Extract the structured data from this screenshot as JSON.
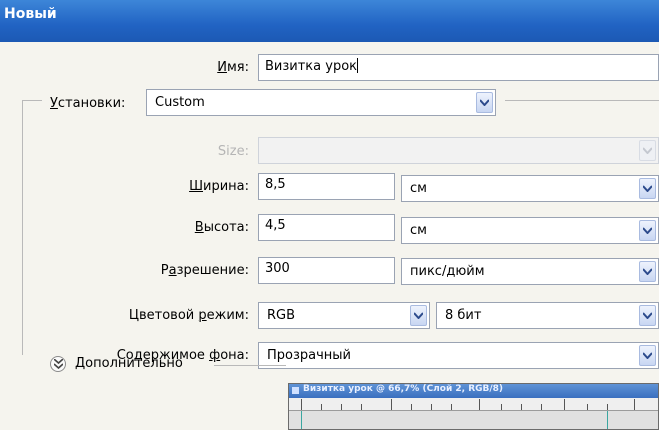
{
  "window": {
    "title": "Новый"
  },
  "form": {
    "name": {
      "label": "Имя:",
      "mnemonic": "И",
      "label_rest": "мя:",
      "value": "Визитка урок"
    },
    "preset": {
      "label": "Установки:",
      "mnemonic": "У",
      "label_rest": "становки:",
      "value": "Custom"
    },
    "size": {
      "label": "Size:",
      "value": ""
    },
    "width": {
      "label": "Ширина:",
      "mnemonic": "Ш",
      "label_rest": "ирина:",
      "value": "8,5",
      "unit": "см"
    },
    "height": {
      "label": "Высота:",
      "mnemonic": "В",
      "label_rest": "ысота:",
      "value": "4,5",
      "unit": "см"
    },
    "resolution": {
      "label": "Разрешение:",
      "pre": "Р",
      "mnemonic": "а",
      "label_rest": "зрешение:",
      "value": "300",
      "unit": "пикс/дюйм"
    },
    "color_mode": {
      "label": "Цветовой режим:",
      "pre": "Цветовой ",
      "mnemonic": "р",
      "label_rest": "ежим:",
      "value": "RGB",
      "depth": "8 бит"
    },
    "background": {
      "label": "Содержимое фона:",
      "pre": "Содержимое ",
      "mnemonic": "ф",
      "label_rest": "она:",
      "value": "Прозрачный"
    },
    "advanced": {
      "label": "Дополнительно"
    }
  },
  "thumbnail": {
    "title": "Визитка урок @ 66,7% (Слой 2, RGB/8)"
  },
  "colors": {
    "titlebar": "#2163c3",
    "dialog_bg": "#f5f4ee",
    "guide": "#3aa6a0"
  }
}
